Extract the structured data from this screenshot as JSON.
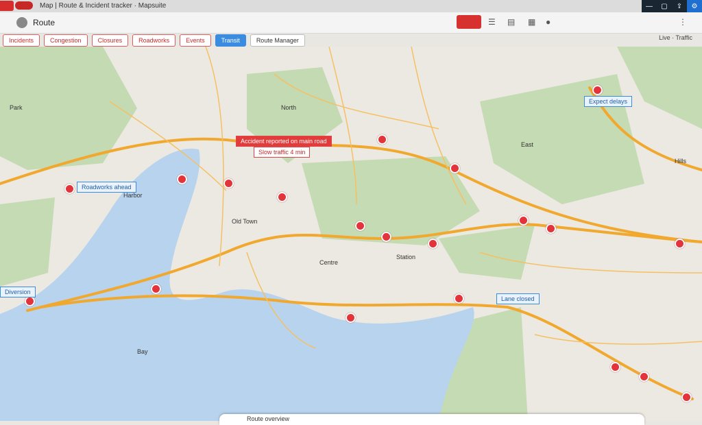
{
  "window": {
    "title": "Map | Route & Incident tracker · Mapsuite"
  },
  "toolbar": {
    "title": "Route"
  },
  "chips": [
    {
      "label": "Incidents"
    },
    {
      "label": "Congestion"
    },
    {
      "label": "Closures"
    },
    {
      "label": "Roadworks"
    },
    {
      "label": "Events"
    },
    {
      "label": "Transit"
    }
  ],
  "active_tab": {
    "label": "Route Manager"
  },
  "status": {
    "text": "Live · Traffic"
  },
  "callouts": [
    {
      "text": "Accident reported on main road",
      "style": "red"
    },
    {
      "text": "Slow traffic 4 min",
      "style": "outline"
    },
    {
      "text": "Roadworks ahead",
      "style": "blue"
    },
    {
      "text": "Expect delays",
      "style": "blue"
    },
    {
      "text": "Lane closed",
      "style": "blue"
    },
    {
      "text": "Diversion",
      "style": "blue"
    }
  ],
  "map_labels": [
    "Park",
    "North",
    "Harbor",
    "Centre",
    "Old Town",
    "East",
    "Station",
    "Bay",
    "Hills"
  ],
  "bottom_card": {
    "text": "Route overview"
  },
  "colors": {
    "road": "#f0a82e",
    "water": "#b8d3ee",
    "green": "#bcd7a9",
    "accent": "#e2343a",
    "link": "#3a8ce0"
  }
}
